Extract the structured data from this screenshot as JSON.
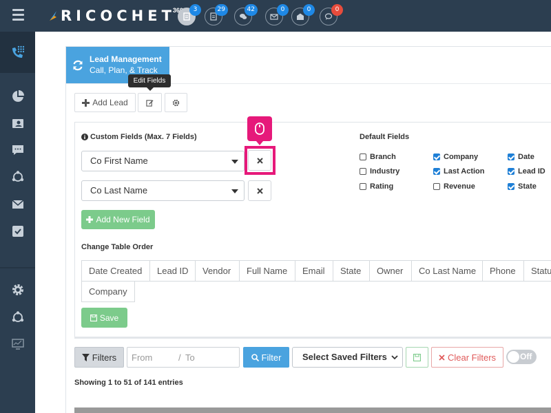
{
  "app": {
    "logo_text": "RICOCHET",
    "logo_sup": "360"
  },
  "top_icons": [
    {
      "name": "leads",
      "badge": "3"
    },
    {
      "name": "documents",
      "badge": "29"
    },
    {
      "name": "chats",
      "badge": "42"
    },
    {
      "name": "mail",
      "badge": "0"
    },
    {
      "name": "inbox",
      "badge": "0"
    },
    {
      "name": "messages",
      "badge": "0"
    }
  ],
  "sidebar": {
    "items": [
      "phone-dialpad",
      "pie-chart",
      "contacts",
      "chat",
      "share",
      "mail",
      "checklist",
      "settings",
      "share",
      "dashboard"
    ]
  },
  "header": {
    "title": "Lead Management",
    "subtitle": "Call, Plan, & Track",
    "tooltip": "Edit Fields"
  },
  "toolbar": {
    "add_lead": "Add Lead"
  },
  "custom_fields": {
    "title": "Custom Fields (Max. 7 Fields)",
    "fields": [
      "Co First Name",
      "Co Last Name"
    ],
    "add_new_field": "Add New Field"
  },
  "default_fields": {
    "title": "Default Fields",
    "items": [
      {
        "label": "Branch",
        "checked": false
      },
      {
        "label": "Company",
        "checked": true
      },
      {
        "label": "Date",
        "checked": true
      },
      {
        "label": "Industry",
        "checked": false
      },
      {
        "label": "Last Action",
        "checked": true
      },
      {
        "label": "Lead ID",
        "checked": true
      },
      {
        "label": "Rating",
        "checked": false
      },
      {
        "label": "Revenue",
        "checked": false
      },
      {
        "label": "State",
        "checked": true
      }
    ]
  },
  "table_order": {
    "title": "Change Table Order",
    "columns": [
      "Date Created",
      "Lead ID",
      "Vendor",
      "Full Name",
      "Email",
      "State",
      "Owner",
      "Co Last Name",
      "Phone",
      "Status",
      "Company"
    ],
    "save": "Save"
  },
  "filters": {
    "filters_button": "Filters",
    "from_placeholder": "From",
    "to_placeholder": "To",
    "filter_button": "Filter",
    "saved_filters": "Select Saved Filters",
    "clear_filters": "Clear Filters",
    "toggle_label": "Off"
  },
  "entries_text": "Showing 1 to 51 of 141 entries",
  "colors": {
    "navbar": "#2c3e50",
    "accent_blue": "#4aa3df",
    "green": "#7ccb8b",
    "highlight": "#e6197a"
  }
}
